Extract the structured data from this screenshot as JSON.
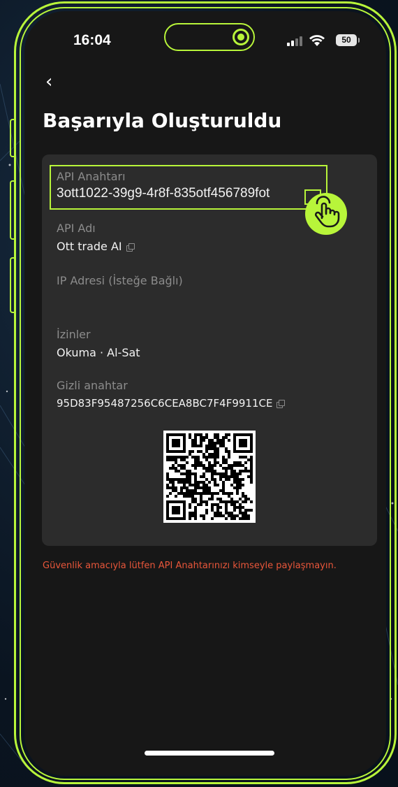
{
  "status_bar": {
    "time": "16:04",
    "battery": "50"
  },
  "header": {
    "back_icon": "chevron-left-icon",
    "title": "Başarıyla Oluşturuldu"
  },
  "details": {
    "api_key_label": "API Anahtarı",
    "api_key_value": "3ott1022-39g9-4r8f-835otf456789fot",
    "api_name_label": "API Adı",
    "api_name_value": "Ott trade AI",
    "ip_label": "IP Adresi (İsteğe Bağlı)",
    "permissions_label": "İzinler",
    "permissions_value": "Okuma · Al-Sat",
    "secret_label": "Gizli anahtar",
    "secret_value": "95D83F95487256C6CEA8BC7F4F9911CE"
  },
  "warning": "Güvenlik amacıyla lütfen API Anahtarınızı kimseyle paylaşmayın.",
  "colors": {
    "accent": "#b8f53a",
    "warning": "#e8563a",
    "card": "#2c2c2c",
    "screen": "#171717"
  }
}
